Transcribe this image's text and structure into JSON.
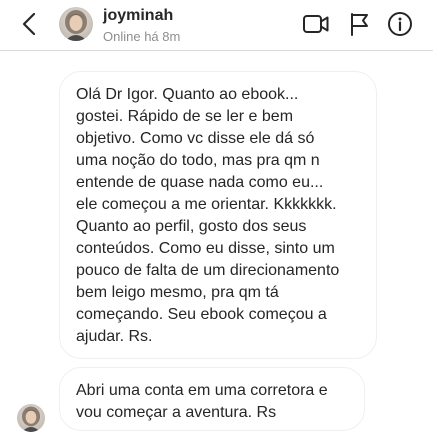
{
  "header": {
    "username": "joyminah",
    "status": "Online há 8m",
    "icons": {
      "back": "chevron-left-icon",
      "video": "video-call-icon",
      "flag": "flag-icon",
      "info": "info-icon"
    }
  },
  "messages": [
    {
      "text": "Olá Dr Igor. Quanto ao ebook...\ngostei. Rápido de se ler e bem\nobjetivo. Como vc disse ele dá só\numa noção do todo, mas pra qm n\nentende de quase nada como eu...\nele começou a me orientar. Kkkkkkk.\nQuanto ao perfil, gosto dos seus\nconteúdos. Como eu disse, sinto um\npouco de falta de um direcionamento\nbem leigo mesmo, pra qm tá\ncomeçando. Seu ebook começou a\najudar. Rs."
    },
    {
      "text": "Abri uma conta em uma corretora e\nvou começar a aventura. Rs"
    }
  ],
  "colors": {
    "text": "#262626",
    "muted": "#8e8e8e",
    "border": "#efefef",
    "divider": "#dbdbdb"
  }
}
